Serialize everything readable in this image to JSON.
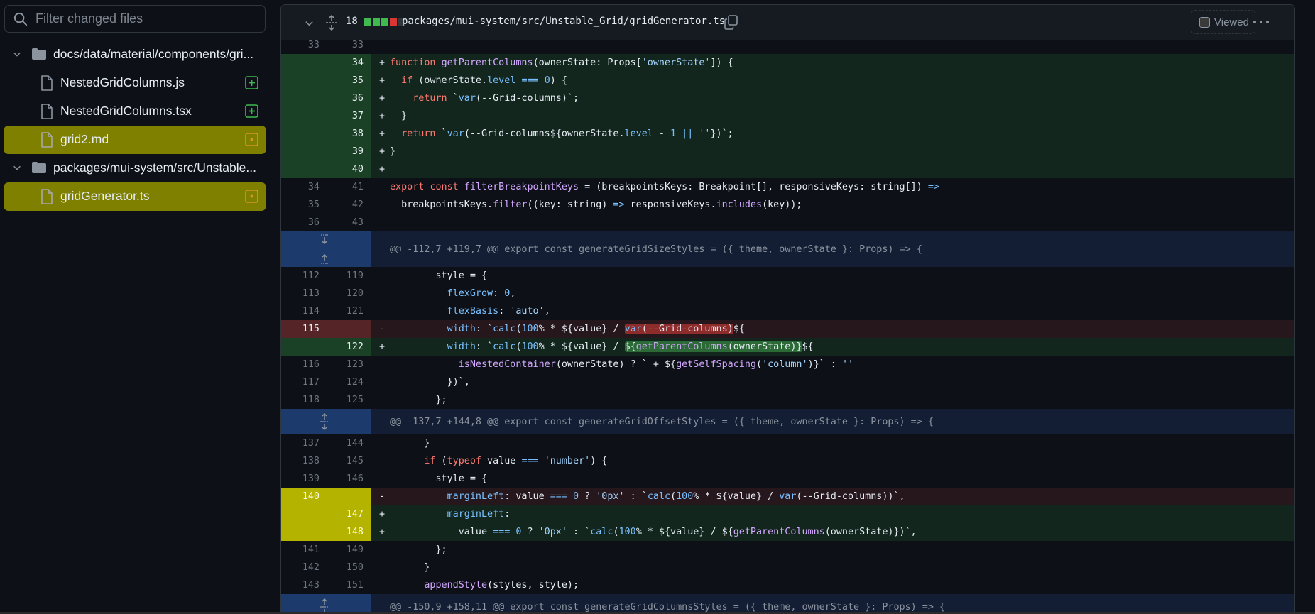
{
  "sidebar": {
    "search": {
      "placeholder": "Filter changed files",
      "value": ""
    },
    "tree": [
      {
        "type": "folder",
        "label": "docs/data/material/components/gri...",
        "expanded": true
      },
      {
        "type": "file",
        "label": "NestedGridColumns.js",
        "status": "added",
        "selected": false
      },
      {
        "type": "file",
        "label": "NestedGridColumns.tsx",
        "status": "added",
        "selected": false
      },
      {
        "type": "file",
        "label": "grid2.md",
        "status": "modified",
        "selected": true
      },
      {
        "type": "folder",
        "label": "packages/mui-system/src/Unstable...",
        "expanded": true
      },
      {
        "type": "file",
        "label": "gridGenerator.ts",
        "status": "modified",
        "selected": true
      }
    ]
  },
  "diff": {
    "changes_count": "18",
    "stats": [
      "add",
      "add",
      "add",
      "del",
      "neutral"
    ],
    "path": "packages/mui-system/src/Unstable_Grid/gridGenerator.ts",
    "viewed_label": "Viewed",
    "viewed": false,
    "hunks": [
      {
        "header": "@@ -112,7 +119,7 @@ export const generateGridSizeStyles = ({ theme, ownerState }: Props) => {"
      },
      {
        "header": "@@ -137,7 +144,8 @@ export const generateGridOffsetStyles = ({ theme, ownerState }: Props) => {"
      },
      {
        "header": "@@ -150,9 +158,11 @@ export const generateGridColumnsStyles = ({ theme, ownerState }: Props) => {"
      }
    ],
    "lines": [
      {
        "old": "33",
        "new": "33",
        "type": "ctx",
        "sign": "",
        "code": ""
      },
      {
        "old": "",
        "new": "34",
        "type": "add",
        "sign": "+",
        "code": "function getParentColumns(ownerState: Props['ownerState']) {"
      },
      {
        "old": "",
        "new": "35",
        "type": "add",
        "sign": "+",
        "code": "  if (ownerState.level === 0) {"
      },
      {
        "old": "",
        "new": "36",
        "type": "add",
        "sign": "+",
        "code": "    return `var(--Grid-columns)`;"
      },
      {
        "old": "",
        "new": "37",
        "type": "add",
        "sign": "+",
        "code": "  }"
      },
      {
        "old": "",
        "new": "38",
        "type": "add",
        "sign": "+",
        "code": "  return `var(--Grid-columns${ownerState.level - 1 || ''})`;"
      },
      {
        "old": "",
        "new": "39",
        "type": "add",
        "sign": "+",
        "code": "}"
      },
      {
        "old": "",
        "new": "40",
        "type": "add",
        "sign": "+",
        "code": ""
      },
      {
        "old": "34",
        "new": "41",
        "type": "ctx",
        "sign": "",
        "code": "export const filterBreakpointKeys = (breakpointsKeys: Breakpoint[], responsiveKeys: string[]) =>"
      },
      {
        "old": "35",
        "new": "42",
        "type": "ctx",
        "sign": "",
        "code": "  breakpointsKeys.filter((key: string) => responsiveKeys.includes(key));"
      },
      {
        "old": "36",
        "new": "43",
        "type": "ctx",
        "sign": "",
        "code": ""
      },
      {
        "old": "112",
        "new": "119",
        "type": "ctx",
        "sign": "",
        "code": "        style = {"
      },
      {
        "old": "113",
        "new": "120",
        "type": "ctx",
        "sign": "",
        "code": "          flexGrow: 0,"
      },
      {
        "old": "114",
        "new": "121",
        "type": "ctx",
        "sign": "",
        "code": "          flexBasis: 'auto',"
      },
      {
        "old": "115",
        "new": "",
        "type": "del",
        "sign": "-",
        "code": "          width: `calc(100% * ${value} / var(--Grid-columns)${"
      },
      {
        "old": "",
        "new": "122",
        "type": "add",
        "sign": "+",
        "code": "          width: `calc(100% * ${value} / ${getParentColumns(ownerState)}${"
      },
      {
        "old": "116",
        "new": "123",
        "type": "ctx",
        "sign": "",
        "code": "            isNestedContainer(ownerState) ? ` + ${getSelfSpacing('column')}` : ''"
      },
      {
        "old": "117",
        "new": "124",
        "type": "ctx",
        "sign": "",
        "code": "          })`,"
      },
      {
        "old": "118",
        "new": "125",
        "type": "ctx",
        "sign": "",
        "code": "        };"
      },
      {
        "old": "137",
        "new": "144",
        "type": "ctx",
        "sign": "",
        "code": "      }"
      },
      {
        "old": "138",
        "new": "145",
        "type": "ctx",
        "sign": "",
        "code": "      if (typeof value === 'number') {"
      },
      {
        "old": "139",
        "new": "146",
        "type": "ctx",
        "sign": "",
        "code": "        style = {"
      },
      {
        "old": "140",
        "new": "",
        "type": "del",
        "sign": "-",
        "code": "          marginLeft: value === 0 ? '0px' : `calc(100% * ${value} / var(--Grid-columns))`,"
      },
      {
        "old": "",
        "new": "147",
        "type": "add",
        "sign": "+",
        "code": "          marginLeft:"
      },
      {
        "old": "",
        "new": "148",
        "type": "add",
        "sign": "+",
        "code": "            value === 0 ? '0px' : `calc(100% * ${value} / ${getParentColumns(ownerState)})`,"
      },
      {
        "old": "141",
        "new": "149",
        "type": "ctx",
        "sign": "",
        "code": "        };"
      },
      {
        "old": "142",
        "new": "150",
        "type": "ctx",
        "sign": "",
        "code": "      }"
      },
      {
        "old": "143",
        "new": "151",
        "type": "ctx",
        "sign": "",
        "code": "      appendStyle(styles, style);"
      }
    ]
  },
  "colors": {
    "selected_row": "#7f7f00",
    "gutter_highlight": "#b4b400",
    "added_badge": "#3fb950",
    "modified_badge": "#d29922",
    "stat_add": "#3fb950",
    "stat_del": "#da3633",
    "stat_neutral": "#30363d"
  }
}
